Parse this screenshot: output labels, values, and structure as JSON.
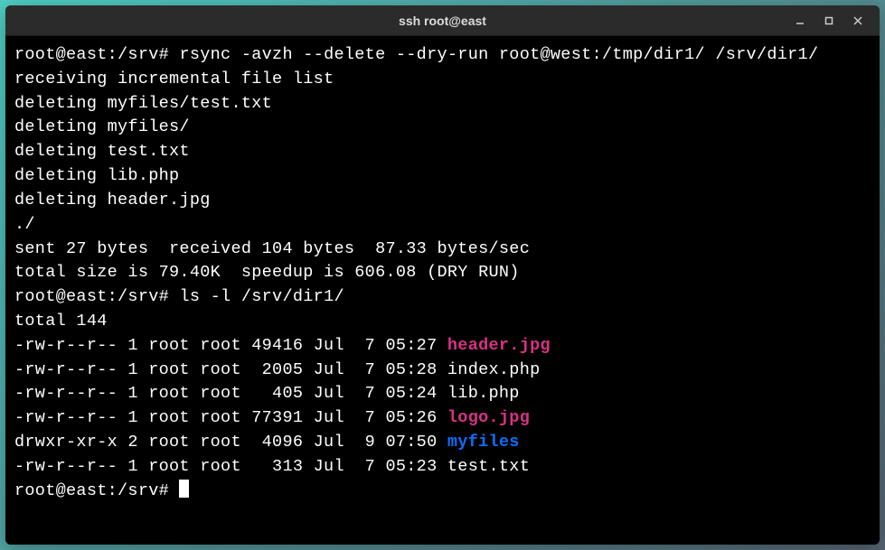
{
  "window": {
    "title": "ssh root@east"
  },
  "terminal": {
    "prompt1": "root@east:/srv# ",
    "cmd1": "rsync -avzh --delete --dry-run root@west:/tmp/dir1/ /srv/dir1/",
    "out1": "receiving incremental file list",
    "out2": "deleting myfiles/test.txt",
    "out3": "deleting myfiles/",
    "out4": "deleting test.txt",
    "out5": "deleting lib.php",
    "out6": "deleting header.jpg",
    "out7": "./",
    "blank": "",
    "out8": "sent 27 bytes  received 104 bytes  87.33 bytes/sec",
    "out9": "total size is 79.40K  speedup is 606.08 (DRY RUN)",
    "prompt2": "root@east:/srv# ",
    "cmd2": "ls -l /srv/dir1/",
    "out10": "total 144",
    "ls": [
      {
        "pre": "-rw-r--r-- 1 root root 49416 Jul  7 05:27 ",
        "name": "header.jpg",
        "cls": "magenta"
      },
      {
        "pre": "-rw-r--r-- 1 root root  2005 Jul  7 05:28 ",
        "name": "index.php",
        "cls": ""
      },
      {
        "pre": "-rw-r--r-- 1 root root   405 Jul  7 05:24 ",
        "name": "lib.php",
        "cls": ""
      },
      {
        "pre": "-rw-r--r-- 1 root root 77391 Jul  7 05:26 ",
        "name": "logo.jpg",
        "cls": "magenta"
      },
      {
        "pre": "drwxr-xr-x 2 root root  4096 Jul  9 07:50 ",
        "name": "myfiles",
        "cls": "blue"
      },
      {
        "pre": "-rw-r--r-- 1 root root   313 Jul  7 05:23 ",
        "name": "test.txt",
        "cls": ""
      }
    ],
    "prompt3": "root@east:/srv# "
  }
}
